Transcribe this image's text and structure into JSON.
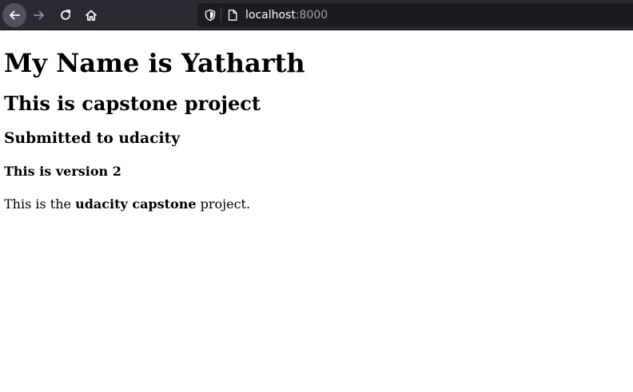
{
  "browser": {
    "url_host": "localhost",
    "url_port": ":8000",
    "icons": {
      "back": "arrow-left-icon",
      "forward": "arrow-right-icon",
      "reload": "reload-icon",
      "home": "home-icon",
      "tracking": "shield-icon",
      "page": "page-icon"
    }
  },
  "page": {
    "heading1": "My Name is Yatharth",
    "heading2": "This is capstone project",
    "heading3": "Submitted to udacity",
    "heading4": "This is version 2",
    "paragraph": {
      "prefix": "This is the ",
      "bold": "udacity capstone",
      "suffix": " project."
    }
  }
}
